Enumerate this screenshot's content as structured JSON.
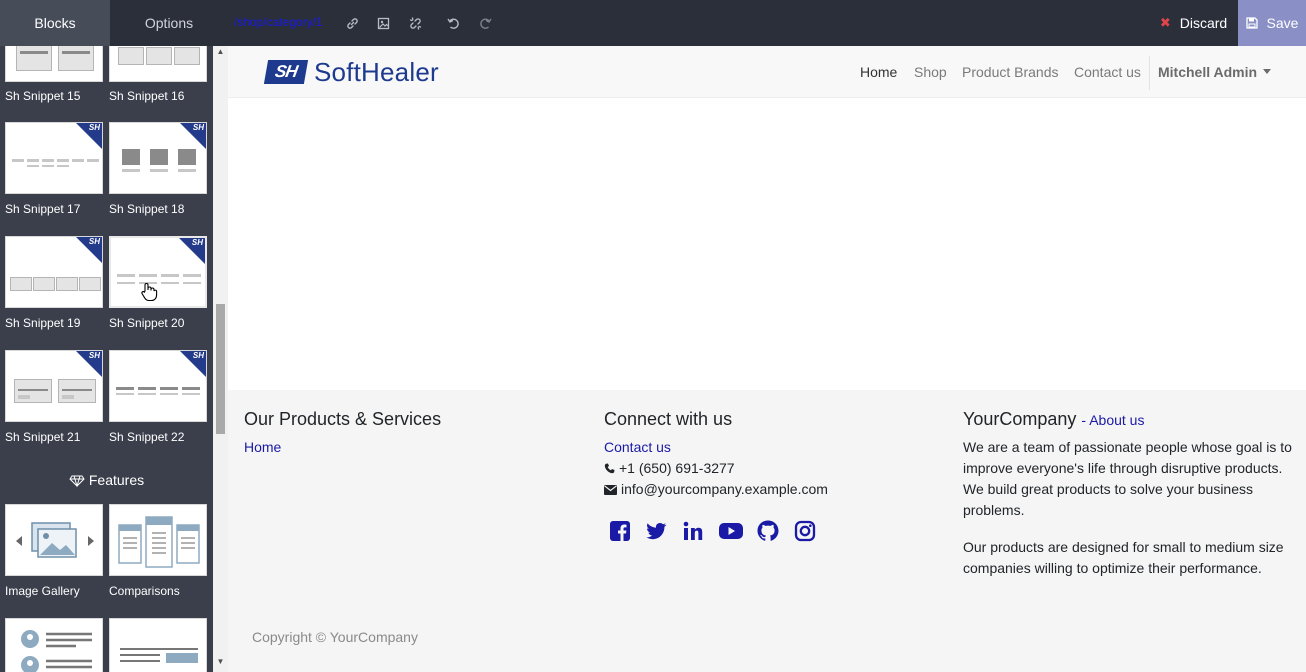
{
  "editor": {
    "tabs": {
      "blocks": "Blocks",
      "options": "Options"
    },
    "url_path": "/shop/category/1",
    "discard_label": "Discard",
    "save_label": "Save"
  },
  "snippets": {
    "items": [
      {
        "label": "Sh Snippet 15"
      },
      {
        "label": "Sh Snippet 16"
      },
      {
        "label": "Sh Snippet 17"
      },
      {
        "label": "Sh Snippet 18"
      },
      {
        "label": "Sh Snippet 19"
      },
      {
        "label": "Sh Snippet 20"
      },
      {
        "label": "Sh Snippet 21"
      },
      {
        "label": "Sh Snippet 22"
      }
    ],
    "badge": "SH",
    "features_title": "Features",
    "features": [
      {
        "label": "Image Gallery"
      },
      {
        "label": "Comparisons"
      }
    ]
  },
  "site": {
    "logo_mark": "SH",
    "logo_text": "SoftHealer",
    "nav": [
      {
        "label": "Home"
      },
      {
        "label": "Shop"
      },
      {
        "label": "Product Brands"
      },
      {
        "label": "Contact us"
      }
    ],
    "user": "Mitchell Admin"
  },
  "footer": {
    "col1": {
      "title": "Our Products & Services",
      "link": "Home"
    },
    "col2": {
      "title": "Connect with us",
      "link": "Contact us",
      "phone": "+1 (650) 691-3277",
      "email": "info@yourcompany.example.com",
      "social_icons": [
        "facebook-icon",
        "twitter-icon",
        "linkedin-icon",
        "youtube-icon",
        "github-icon",
        "instagram-icon"
      ]
    },
    "col3": {
      "title": "YourCompany",
      "title_link": "- About us",
      "para1": "We are a team of passionate people whose goal is to improve everyone's life through disruptive products. We build great products to solve your business problems.",
      "para2": "Our products are designed for small to medium size companies willing to optimize their performance."
    },
    "copyright": "Copyright © YourCompany"
  },
  "colors": {
    "sidebar_bg": "#3b3f4b",
    "editor_bar": "#2b2f3a",
    "save_bg": "#8a8fc6",
    "brand_blue": "#1d3a8f",
    "link_color": "#1a1aa6",
    "discard_x": "#e0454a"
  }
}
